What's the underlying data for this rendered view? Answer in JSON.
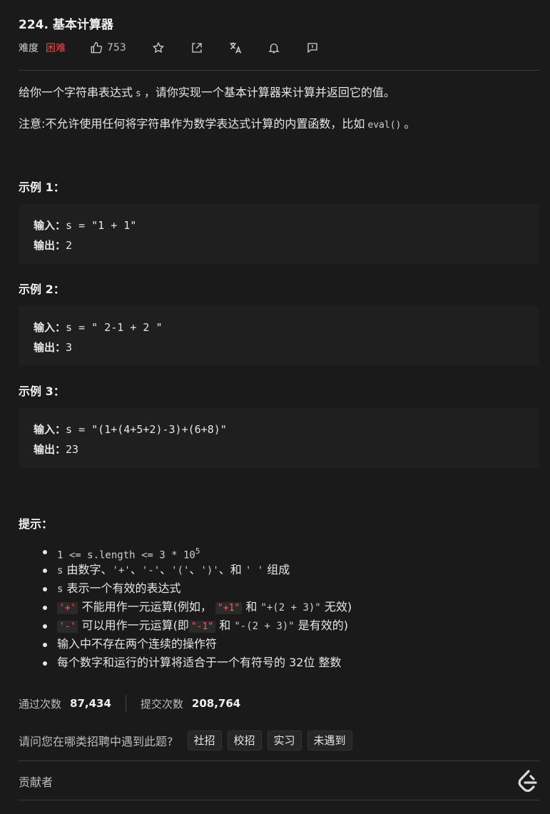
{
  "header": {
    "title": "224. 基本计算器",
    "difficulty_label": "难度",
    "difficulty": "困难",
    "likes": "753"
  },
  "description": {
    "p1_a": "给你一个字符串表达式",
    "p1_code": "s",
    "p1_b": "，请你实现一个基本计算器来计算并返回它的值。",
    "p2_a": "注意:不允许使用任何将字符串作为数学表达式计算的内置函数，比如",
    "p2_code": "eval()",
    "p2_b": "。"
  },
  "examples": [
    {
      "title": "示例 1：",
      "input_label": "输入：",
      "input": "s = \"1 + 1\"",
      "output_label": "输出：",
      "output": "2"
    },
    {
      "title": "示例 2：",
      "input_label": "输入：",
      "input": "s = \" 2-1 + 2 \"",
      "output_label": "输出：",
      "output": "3"
    },
    {
      "title": "示例 3：",
      "input_label": "输入：",
      "input": "s = \"(1+(4+5+2)-3)+(6+8)\"",
      "output_label": "输出：",
      "output": "23"
    }
  ],
  "hints": {
    "title": "提示：",
    "h1_a": "1 <= s.length <= 3 * 10",
    "h1_sup": "5",
    "h2_code": "s",
    "h2_a": "由数字、",
    "h2_b": "'+'",
    "h2_c": "、",
    "h2_d": "'-'",
    "h2_e": "、",
    "h2_f": "'('",
    "h2_g": "、",
    "h2_h": "')'",
    "h2_i": "、和",
    "h2_j": "' '",
    "h2_k": "组成",
    "h3_code": "s",
    "h3_a": "表示一个有效的表达式",
    "h4_red1": "'+'",
    "h4_a": "不能用作一元运算(例如，",
    "h4_red2": "\"+1\"",
    "h4_b": "和",
    "h4_code": "\"+(2 + 3)\"",
    "h4_c": "无效)",
    "h5_red1": "'-'",
    "h5_a": "可以用作一元运算(即",
    "h5_red2": "\"-1\"",
    "h5_b": "和",
    "h5_code": "\"-(2 + 3)\"",
    "h5_c": "是有效的)",
    "h6": "输入中不存在两个连续的操作符",
    "h7": "每个数字和运行的计算将适合于一个有符号的 32位 整数"
  },
  "stats": {
    "accepted_label": "通过次数",
    "accepted": "87,434",
    "submitted_label": "提交次数",
    "submitted": "208,764"
  },
  "interview": {
    "question": "请问您在哪类招聘中遇到此题?",
    "tags": [
      "社招",
      "校招",
      "实习",
      "未遇到"
    ]
  },
  "contributors_label": "贡献者",
  "icons": [
    "thumb-up-icon",
    "star-icon",
    "share-icon",
    "translate-icon",
    "bell-icon",
    "feedback-icon",
    "leetcode-logo"
  ],
  "colors": {
    "difficulty_hard": "#ef4743",
    "background": "#1a1a1a"
  }
}
